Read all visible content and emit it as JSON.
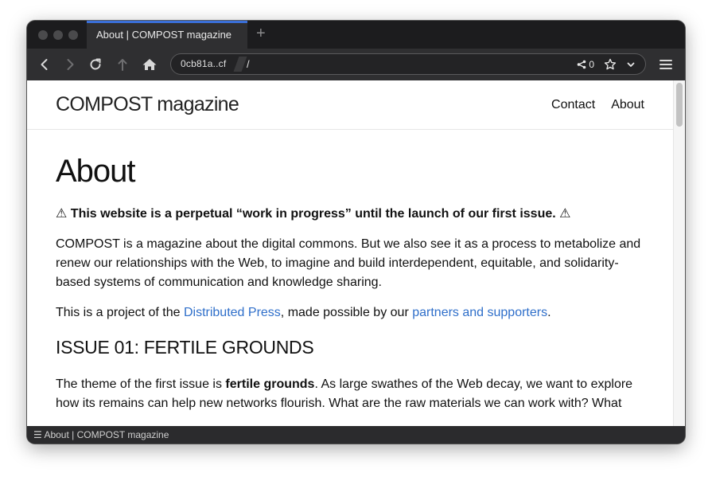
{
  "browser": {
    "tab_title": "About | COMPOST magazine",
    "new_tab_symbol": "+",
    "url_host": "0cb81a..cf",
    "url_path": "/",
    "share_count": "0",
    "status_text": "About | COMPOST magazine",
    "status_icon": "☰"
  },
  "site": {
    "title": "COMPOST magazine",
    "nav": [
      {
        "label": "Contact"
      },
      {
        "label": "About"
      }
    ]
  },
  "page": {
    "heading": "About",
    "warning_icon": "⚠",
    "warning": "This website is a perpetual “work in progress” until the launch of our first issue.",
    "intro": "COMPOST is a magazine about the digital commons. But we also see it as a process to metabolize and renew our relationships with the Web, to imagine and build interdependent, equitable, and solidarity-based systems of communication and knowledge sharing.",
    "project_prefix": "This is a project of the ",
    "project_link1": "Distributed Press",
    "project_mid": ", made possible by our ",
    "project_link2": "partners and supporters",
    "project_suffix": ".",
    "issue_heading": "ISSUE 01: FERTILE GROUNDS",
    "theme_prefix": "The theme of the first issue is ",
    "theme_bold": "fertile grounds",
    "theme_rest": ". As large swathes of the Web decay, we want to explore how its remains can help new networks flourish. What are the raw materials we can work with? What"
  },
  "colors": {
    "link": "#2f6fca",
    "accent_tab": "#3a6fd8"
  },
  "icons": [
    "back-icon",
    "forward-icon",
    "reload-icon",
    "upload-icon",
    "home-icon",
    "share-icon",
    "star-icon",
    "chevron-down-icon",
    "menu-icon"
  ]
}
